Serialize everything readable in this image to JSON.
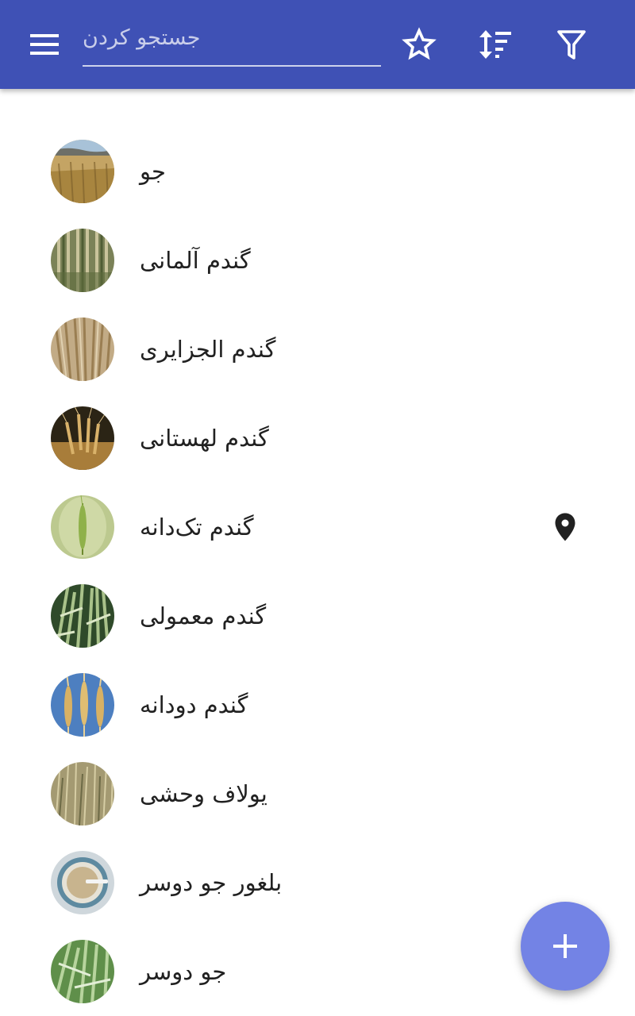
{
  "toolbar": {
    "menu_icon": "hamburger-menu-icon",
    "search_placeholder": "جستجو کردن",
    "search_value": "",
    "favorites_icon": "star-outline-icon",
    "sort_icon": "sort-icon",
    "filter_icon": "filter-icon",
    "color": "#3f51b5"
  },
  "items": [
    {
      "label": "جو",
      "thumb": "barley-field-photo"
    },
    {
      "label": "گندم آلمانی",
      "thumb": "emmer-wheat-photo"
    },
    {
      "label": "گندم الجزایری",
      "thumb": "durum-wheat-photo"
    },
    {
      "label": "گندم لهستانی",
      "thumb": "polish-wheat-photo"
    },
    {
      "label": "گندم تک‌دانه",
      "thumb": "einkorn-wheat-photo",
      "location_icon": "map-marker-icon"
    },
    {
      "label": "گندم معمولی",
      "thumb": "common-wheat-photo"
    },
    {
      "label": "گندم دودانه",
      "thumb": "emmer-spikes-photo"
    },
    {
      "label": "یولاف وحشی",
      "thumb": "wild-oat-photo"
    },
    {
      "label": "بلغور جو دوسر",
      "thumb": "oatmeal-bowl-photo"
    },
    {
      "label": "جو دوسر",
      "thumb": "oat-plant-photo"
    }
  ],
  "fab": {
    "icon": "plus-icon",
    "color": "#7383e5"
  }
}
